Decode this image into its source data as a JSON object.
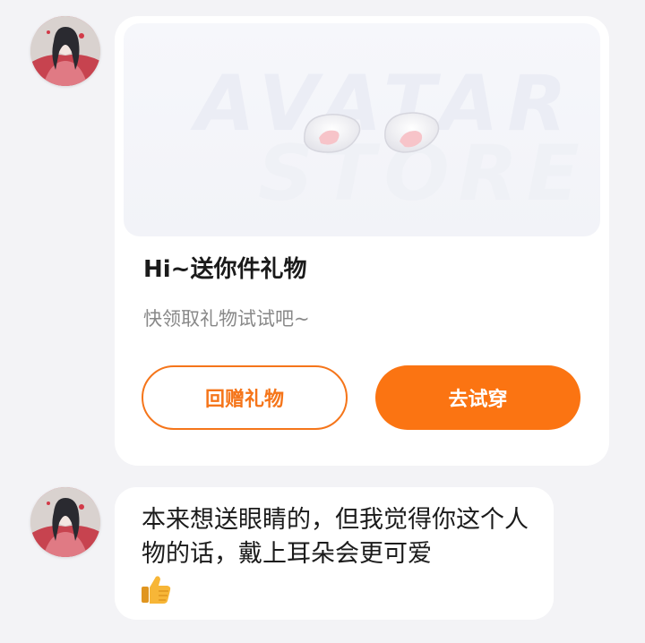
{
  "chat": {
    "gift_card": {
      "watermark_line1": "AVATAR",
      "watermark_line2": "STORE",
      "gift_item_icon": "bunny-ears-icon",
      "title": "Hi~送你件礼物",
      "subtitle": "快领取礼物试试吧~",
      "return_gift_label": "回赠礼物",
      "try_on_label": "去试穿",
      "accent_color": "#fb7412"
    },
    "message": {
      "text": "本来想送眼睛的，但我觉得你这个人物的话，戴上耳朵会更可爱",
      "emoji_icon": "thumbs-up-icon"
    }
  }
}
